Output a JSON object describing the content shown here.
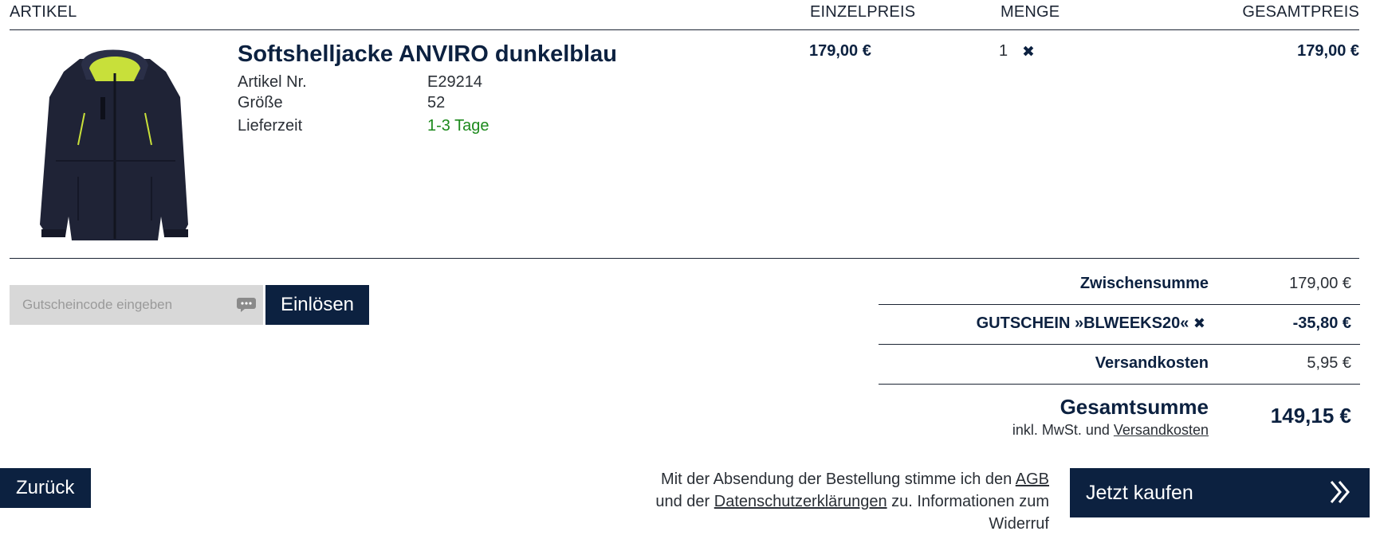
{
  "table_header": {
    "article": "ARTIKEL",
    "unit_price": "EINZELPREIS",
    "quantity": "MENGE",
    "total_price": "GESAMTPREIS"
  },
  "product": {
    "title": "Softshelljacke ANVIRO dunkelblau",
    "image_icon": "jacket-product-image",
    "attributes": [
      {
        "label": "Artikel Nr.",
        "value": "E29214"
      },
      {
        "label": "Größe",
        "value": "52"
      },
      {
        "label": "Lieferzeit",
        "value": "1-3 Tage"
      }
    ],
    "unit_price": "179,00 €",
    "quantity": "1",
    "total_price": "179,00 €",
    "delivery_color": "#1d8a1d"
  },
  "voucher": {
    "placeholder": "Gutscheincode eingeben",
    "icon": "speech-bubble-icon",
    "button_label": "Einlösen"
  },
  "summary": {
    "subtotal_label": "Zwischensumme",
    "subtotal_value": "179,00 €",
    "voucher_label": "GUTSCHEIN »BLWEEKS20«",
    "voucher_value": "-35,80 €",
    "shipping_label": "Versandkosten",
    "shipping_value": "5,95 €",
    "total_label": "Gesamtsumme",
    "total_value": "149,15 €",
    "tax_note_prefix": "inkl. MwSt. und",
    "tax_note_link": "Versandkosten"
  },
  "footer": {
    "back_label": "Zurück",
    "terms_part1": "Mit der Absendung der Bestellung stimme ich den",
    "terms_agb": "AGB",
    "terms_part2": "und der",
    "terms_privacy": "Datenschutzerklärungen",
    "terms_part3": "zu. Informationen zum Widerruf",
    "buy_label": "Jetzt kaufen"
  },
  "colors": {
    "brand_dark": "#0c2140",
    "input_bg": "#d8d8d8"
  }
}
